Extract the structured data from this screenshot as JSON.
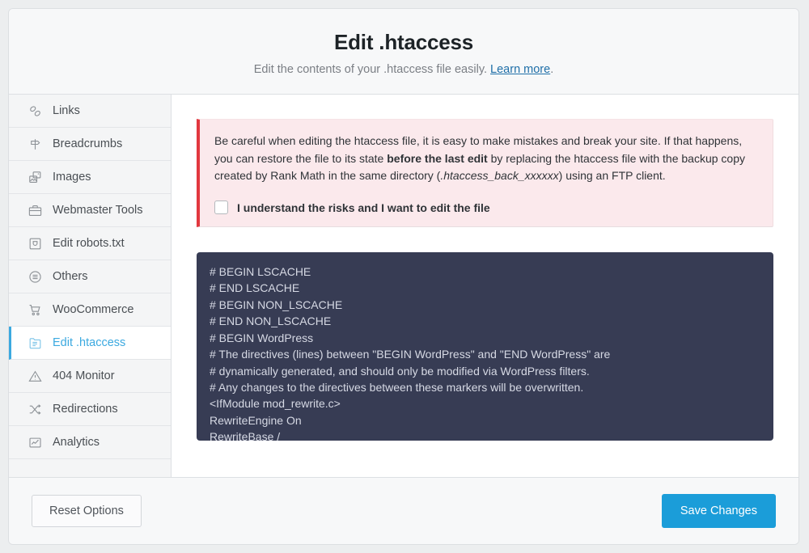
{
  "header": {
    "title": "Edit .htaccess",
    "subtitle_before": "Edit the contents of your .htaccess file easily. ",
    "link_label": "Learn more",
    "subtitle_after": "."
  },
  "sidebar": {
    "items": [
      {
        "label": "Links",
        "icon": "link-icon",
        "active": false
      },
      {
        "label": "Breadcrumbs",
        "icon": "signpost-icon",
        "active": false
      },
      {
        "label": "Images",
        "icon": "images-icon",
        "active": false
      },
      {
        "label": "Webmaster Tools",
        "icon": "briefcase-icon",
        "active": false
      },
      {
        "label": "Edit robots.txt",
        "icon": "robots-file-icon",
        "active": false
      },
      {
        "label": "Others",
        "icon": "list-circle-icon",
        "active": false
      },
      {
        "label": "WooCommerce",
        "icon": "shopping-cart-icon",
        "active": false
      },
      {
        "label": "Edit .htaccess",
        "icon": "document-icon",
        "active": true
      },
      {
        "label": "404 Monitor",
        "icon": "warning-triangle-icon",
        "active": false
      },
      {
        "label": "Redirections",
        "icon": "shuffle-arrows-icon",
        "active": false
      },
      {
        "label": "Analytics",
        "icon": "chart-box-icon",
        "active": false
      }
    ]
  },
  "notice": {
    "text_part1": "Be careful when editing the htaccess file, it is easy to make mistakes and break your site. If that happens, you can restore the file to its state ",
    "text_bold": "before the last edit",
    "text_part2": " by replacing the htaccess file with the backup copy created by Rank Math in the same directory (",
    "text_italic": ".htaccess_back_xxxxxx",
    "text_part3": ") using an FTP client.",
    "checkbox_label": "I understand the risks and I want to edit the file",
    "checkbox_checked": false,
    "accent_color": "#e2383f",
    "background_color": "#fbe9ec"
  },
  "editor": {
    "content": "# BEGIN LSCACHE\n# END LSCACHE\n# BEGIN NON_LSCACHE\n# END NON_LSCACHE\n# BEGIN WordPress\n# The directives (lines) between \"BEGIN WordPress\" and \"END WordPress\" are\n# dynamically generated, and should only be modified via WordPress filters.\n# Any changes to the directives between these markers will be overwritten.\n<IfModule mod_rewrite.c>\nRewriteEngine On\nRewriteBase /",
    "background_color": "#373c54",
    "text_color": "#d6d9e4"
  },
  "footer": {
    "reset_label": "Reset Options",
    "save_label": "Save Changes",
    "save_color": "#1b9dd9"
  }
}
